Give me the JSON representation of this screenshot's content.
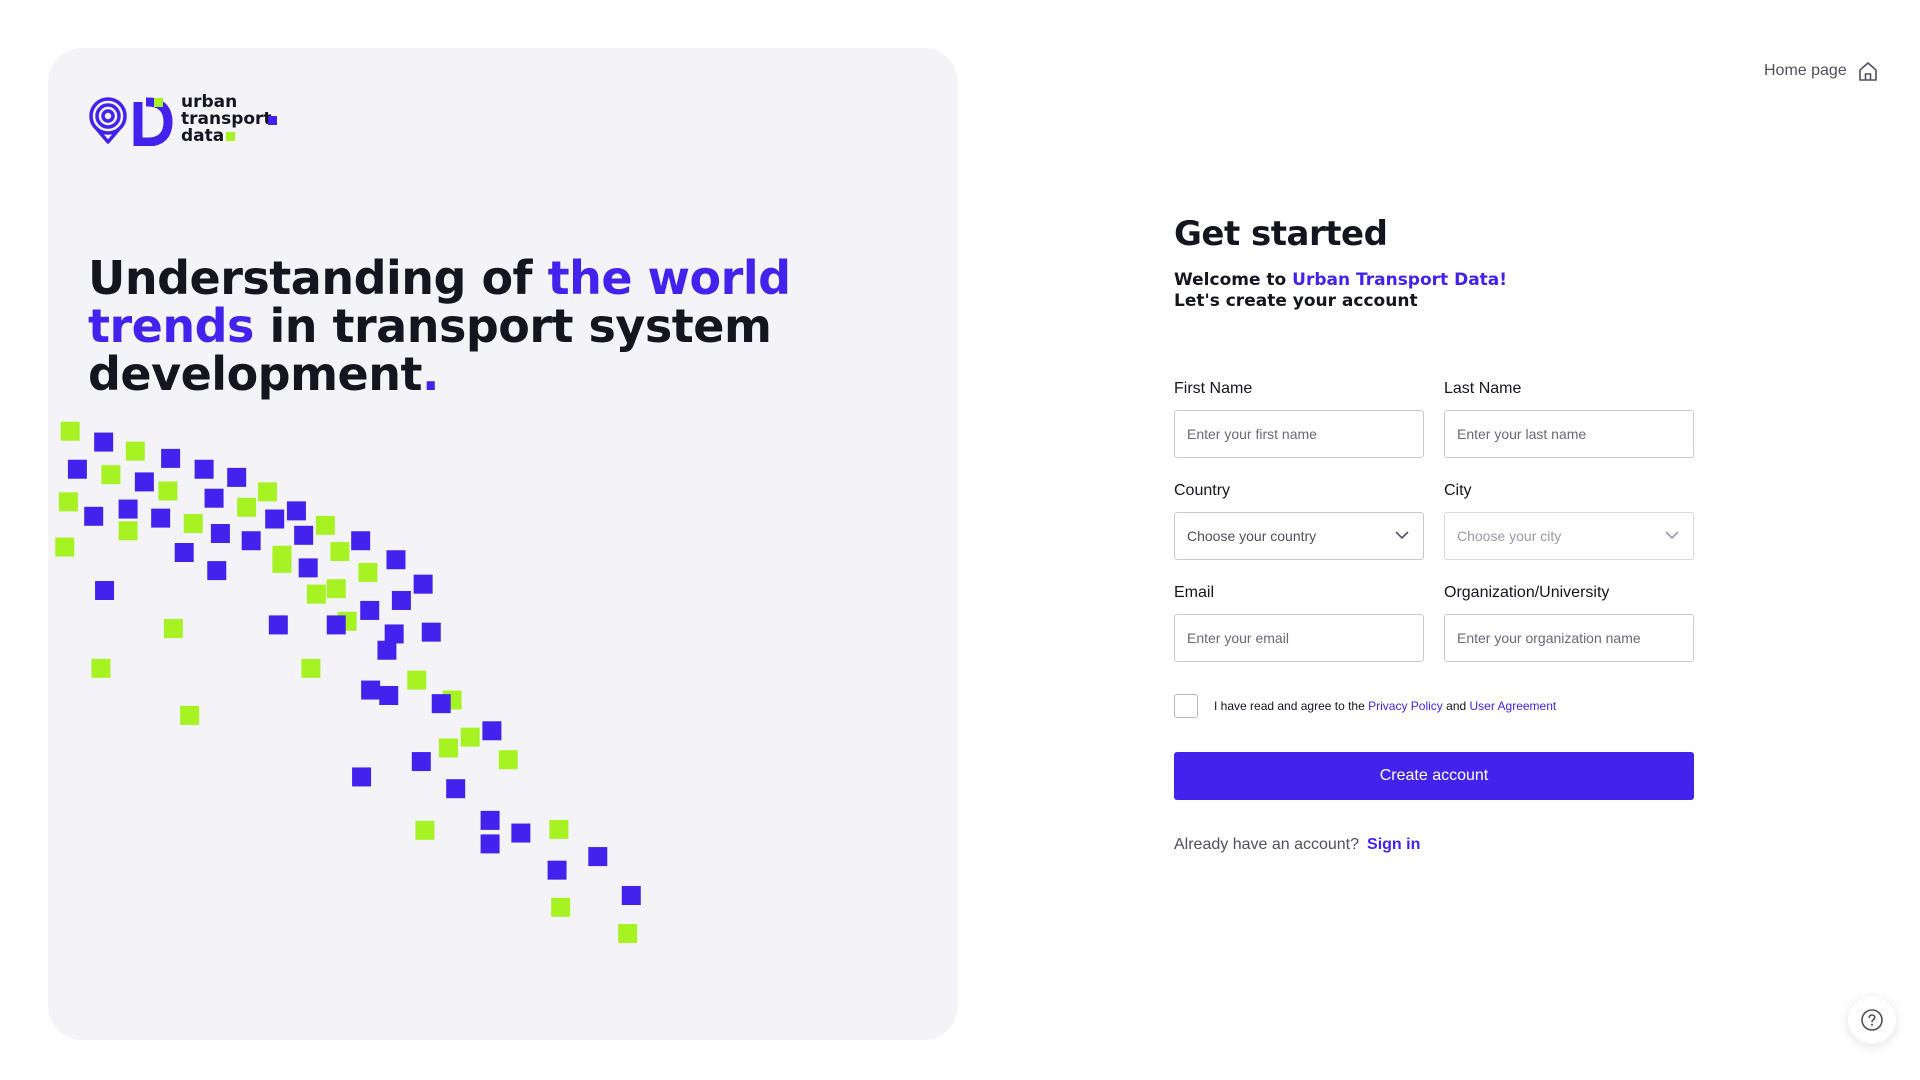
{
  "brand": {
    "name_lines": [
      "urban",
      "transport",
      "data"
    ],
    "accent_color": "#4422ee",
    "secondary_color": "#a6f223"
  },
  "hero": {
    "headline_part1": "Understanding of ",
    "headline_accent1": "the world",
    "headline_accent2": "trends",
    "headline_part2": " in transport system development",
    "headline_period": "."
  },
  "header": {
    "home_link_label": "Home page",
    "home_icon": "home-icon"
  },
  "form": {
    "title": "Get started",
    "welcome_prefix": "Welcome to ",
    "welcome_brand": "Urban Transport Data!",
    "welcome_line2": "Let's create your account",
    "fields": {
      "first_name": {
        "label": "First Name",
        "placeholder": "Enter your first name"
      },
      "last_name": {
        "label": "Last Name",
        "placeholder": "Enter your last name"
      },
      "country": {
        "label": "Country",
        "value": "Choose your country"
      },
      "city": {
        "label": "City",
        "value": "Choose your city"
      },
      "email": {
        "label": "Email",
        "placeholder": "Enter your email"
      },
      "organization": {
        "label": "Organization/University",
        "placeholder": "Enter your organization name"
      }
    },
    "agreement": {
      "prefix": "I have read and agree to the ",
      "privacy_link": "Privacy Policy",
      "and": " and ",
      "user_agreement_link": "User Agreement"
    },
    "submit_label": "Create account",
    "signin_prompt": "Already have an account?",
    "signin_link": "Sign in"
  },
  "help": {
    "icon": "question-circle-icon"
  }
}
